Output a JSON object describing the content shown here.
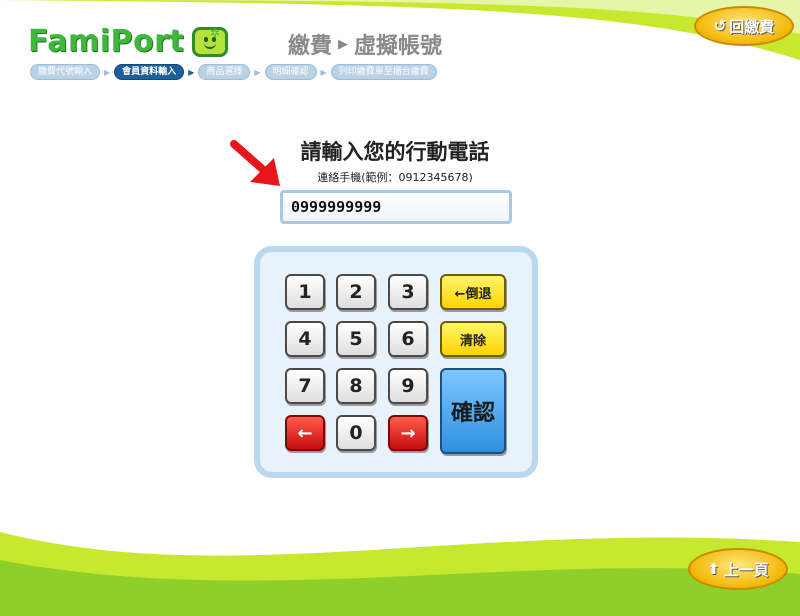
{
  "header": {
    "logo_text": "FamiPort",
    "title_main": "繳費",
    "title_sub": "虛擬帳號",
    "return_label": "回繳費"
  },
  "breadcrumb": {
    "steps": [
      {
        "label": "繳費代號輸入",
        "active": false
      },
      {
        "label": "會員資料輸入",
        "active": true
      },
      {
        "label": "商品選擇",
        "active": false
      },
      {
        "label": "明細確認",
        "active": false
      },
      {
        "label": "列印繳費單至櫃台繳費",
        "active": false
      }
    ]
  },
  "prompt": {
    "title": "請輸入您的行動電話",
    "subtitle": "連絡手機(範例：0912345678)"
  },
  "phone_input": {
    "value": "0999999999"
  },
  "keypad": {
    "digits": [
      "1",
      "2",
      "3",
      "4",
      "5",
      "6",
      "7",
      "8",
      "9",
      "0"
    ],
    "backspace_label": "←倒退",
    "clear_label": "清除",
    "confirm_label": "確認",
    "left_arrow": "←",
    "right_arrow": "→"
  },
  "footer": {
    "prev_label": "上一頁"
  },
  "colors": {
    "brand_green": "#3db83d",
    "wave_green": "#c6e82f",
    "breadcrumb_active": "#1d5f99",
    "breadcrumb_inactive": "#b8d2e6",
    "button_gold": "#f2b705"
  }
}
